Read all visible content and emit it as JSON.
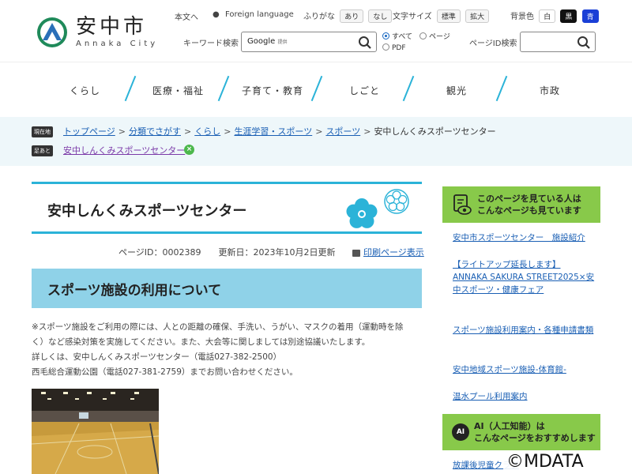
{
  "header": {
    "logo_name": "安中市",
    "logo_roman": "Annaka City",
    "honbun": "本文へ",
    "foreign": "Foreign language",
    "furigana_label": "ふりがな",
    "furigana_on": "あり",
    "furigana_off": "なし",
    "fontsize_label": "文字サイズ",
    "fontsize_normal": "標準",
    "fontsize_large": "拡大",
    "bgcolor_label": "背景色",
    "bg_white": "白",
    "bg_black": "黒",
    "bg_blue": "青",
    "keyword_label": "キーワード検索",
    "search_google": "Google",
    "search_teikyo": "提供",
    "radio_all": "すべて",
    "radio_page": "ページ",
    "radio_pdf": "PDF",
    "pageid_label": "ページID検索"
  },
  "nav": {
    "items": [
      "くらし",
      "医療・福祉",
      "子育て・教育",
      "しごと",
      "観光",
      "市政"
    ]
  },
  "breadcrumb": {
    "current_badge": "現在地",
    "items": [
      "トップページ",
      "分類でさがす",
      "くらし",
      "生涯学習・スポーツ",
      "スポーツ"
    ],
    "current": "安中しんくみスポーツセンター",
    "trail_badge": "足あと",
    "trail_link": "安中しんくみスポーツセンター"
  },
  "main": {
    "title": "安中しんくみスポーツセンター",
    "page_id": "ページID：0002389",
    "updated": "更新日：2023年10月2日更新",
    "print": "印刷ページ表示",
    "section_title": "スポーツ施設の利用について",
    "para1_line1": "※スポーツ施設をご利用の際には、人との距離の確保、手洗い、うがい、マスクの着用（運動時を除",
    "para1_line2": "く）など感染対策を実施してください。また、大会等に関しましては別途協議いたします。",
    "para2_line1": "詳しくは、安中しんくみスポーツセンター（電話027-382-2500）",
    "para2_line2": "西毛総合運動公園（電話027-381-2759）までお問い合わせください。"
  },
  "sidebar": {
    "head1_line1": "このページを見ている人は",
    "head1_line2": "こんなページも見ています",
    "links": [
      "安中市スポーツセンター　施設紹介",
      "【ライトアップ延長します】ANNAKA SAKURA STREET2025×安中スポーツ・健康フェア",
      "スポーツ施設利用案内・各種申請書類",
      "安中地域スポーツ施設-体育館-",
      "温水プール利用案内"
    ],
    "ai_badge": "AI",
    "head2_line1": "AI（人工知能）は",
    "head2_line2": "こんなページをおすすめします",
    "ai_link": "放課後児童クラブ"
  },
  "watermark": "©MDATA",
  "colors": {
    "accent": "#2bb3d8",
    "sidebar_green": "#88c94a",
    "link": "#1a5fb4",
    "heading_bg": "#8fd2e8"
  }
}
